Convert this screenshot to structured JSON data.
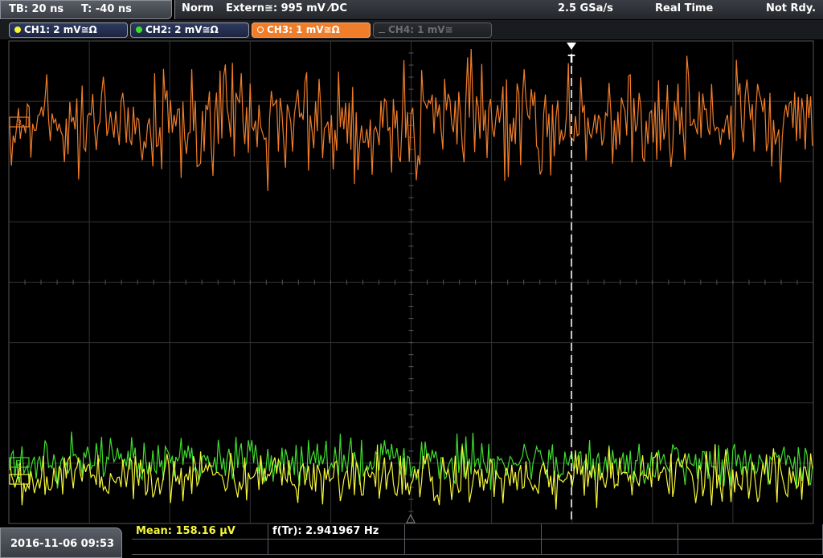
{
  "header": {
    "timebase": "TB: 20 ns",
    "trigger_time": "T: -40 ns",
    "trigger_mode": "Norm",
    "trigger_source": "Extern≅: 995 mV ⁄DC",
    "sample_rate": "2.5 GSa/s",
    "acq_mode": "Real Time",
    "status": "Not Rdy."
  },
  "channels": [
    {
      "label": "CH1: 2 mV≅Ω",
      "color": "#f5f53a",
      "state": "on"
    },
    {
      "label": "CH2: 2 mV≅Ω",
      "color": "#3fdc2f",
      "state": "on"
    },
    {
      "label": "CH3: 1 mV≅Ω",
      "color": "#f07d2a",
      "state": "active"
    },
    {
      "label": "CH4: 1 mV≅",
      "color": "#6a6d73",
      "state": "off"
    }
  ],
  "markers": {
    "trigger": "T",
    "ch3_ref": "3",
    "ch2_ref": "2",
    "ch1_ref": "1"
  },
  "footer": {
    "datetime": "2016-11-06 09:53",
    "measurements": [
      {
        "label": "Mean: 158.16 μV",
        "color": "#f5f53a"
      },
      {
        "label": "f(Tr): 2.941967 Hz",
        "color": "#ffffff"
      }
    ]
  },
  "colors": {
    "ch1": "#f5f53a",
    "ch2": "#3fdc2f",
    "ch3": "#f07d2a",
    "grid": "#3a3a3a"
  }
}
